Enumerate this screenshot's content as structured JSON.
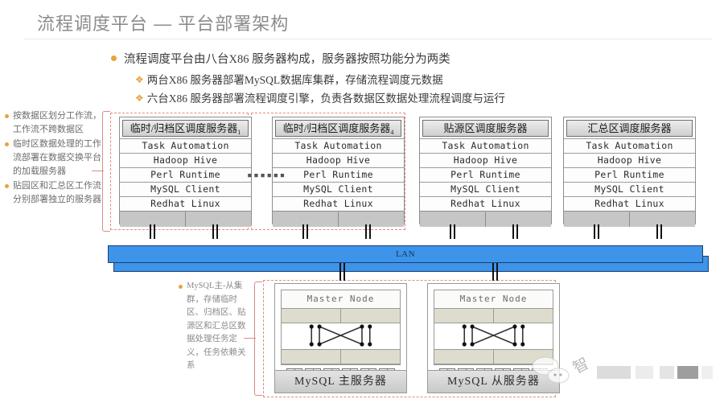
{
  "slide": {
    "title": "流程调度平台 — 平台部署架构",
    "accent_orange": "#e8a33d",
    "accent_red_dashed": "#e6897f",
    "lan_blue": "#3d94e8"
  },
  "bullets": {
    "level1": "流程调度平台由八台X86 服务器构成，服务器按照功能分为两类",
    "level2": [
      "两台X86 服务器部署MySQL数据库集群，存储流程调度元数据",
      "六台X86 服务器部署流程调度引擎，负责各数据区数据处理流程调度与运行"
    ]
  },
  "left_notes": [
    "按数据区划分工作流，工作流不跨数据区",
    "临时区数据处理的工作流部署在数据交换平台的加载服务器",
    "贴园区和汇总区工作流分别部署独立的服务器"
  ],
  "bottom_note": "MySQL主-从集群，存储临时区、归档区、贴源区和汇总区数据处理任务定义，任务依赖关系",
  "servers": [
    {
      "title": "临时/归档区调度服务器",
      "subscript": "1",
      "stack": [
        "Task Automation",
        "Hadoop Hive",
        "Perl Runtime",
        "MySQL Client",
        "Redhat Linux"
      ]
    },
    {
      "title": "临时/归档区调度服务器",
      "subscript": "4",
      "stack": [
        "Task Automation",
        "Hadoop Hive",
        "Perl Runtime",
        "MySQL Client",
        "Redhat Linux"
      ]
    },
    {
      "title": "贴源区调度服务器",
      "subscript": "",
      "stack": [
        "Task Automation",
        "Hadoop Hive",
        "Perl Runtime",
        "MySQL Client",
        "Redhat Linux"
      ]
    },
    {
      "title": "汇总区调度服务器",
      "subscript": "",
      "stack": [
        "Task Automation",
        "Hadoop Hive",
        "Perl Runtime",
        "MySQL Client",
        "Redhat Linux"
      ]
    }
  ],
  "ellipsis": "▪▪▪▪▪▪",
  "network": {
    "label": "LAN"
  },
  "databases": [
    {
      "node_label": "Master Node",
      "footer": "MySQL 主服务器"
    },
    {
      "node_label": "Master Node",
      "footer": "MySQL 从服务器"
    }
  ],
  "watermark": {
    "char": "智"
  }
}
